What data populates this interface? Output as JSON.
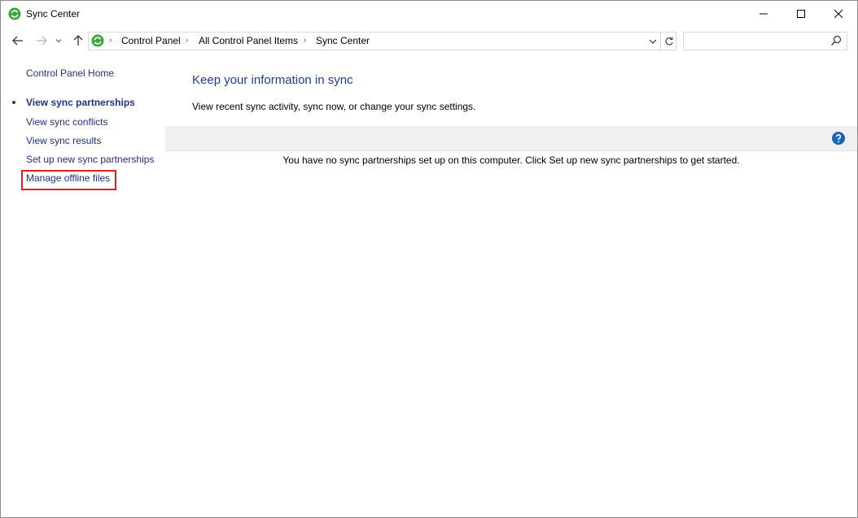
{
  "window": {
    "title": "Sync Center",
    "icon": "sync-center-icon"
  },
  "navigation": {
    "back_icon": "back-arrow-icon",
    "forward_icon": "forward-arrow-icon",
    "recent_icon": "chevron-down-icon",
    "up_icon": "up-arrow-icon"
  },
  "address_bar": {
    "breadcrumbs": [
      "Control Panel",
      "All Control Panel Items",
      "Sync Center"
    ],
    "separator": "›"
  },
  "search": {
    "placeholder": "",
    "value": ""
  },
  "sidebar": {
    "home": "Control Panel Home",
    "items": [
      {
        "label": "View sync partnerships",
        "active": true
      },
      {
        "label": "View sync conflicts",
        "active": false
      },
      {
        "label": "View sync results",
        "active": false
      },
      {
        "label": "Set up new sync partnerships",
        "active": false
      },
      {
        "label": "Manage offline files",
        "active": false,
        "highlighted": true
      }
    ]
  },
  "main": {
    "title": "Keep your information in sync",
    "description": "View recent sync activity, sync now, or change your sync settings.",
    "empty_message": "You have no sync partnerships set up on this computer. Click Set up new sync partnerships to get started."
  },
  "colors": {
    "link": "#1e3287",
    "title": "#1e3c96",
    "highlight": "#e02020",
    "sync_green": "#3aa83a",
    "help_blue": "#1565c0"
  }
}
